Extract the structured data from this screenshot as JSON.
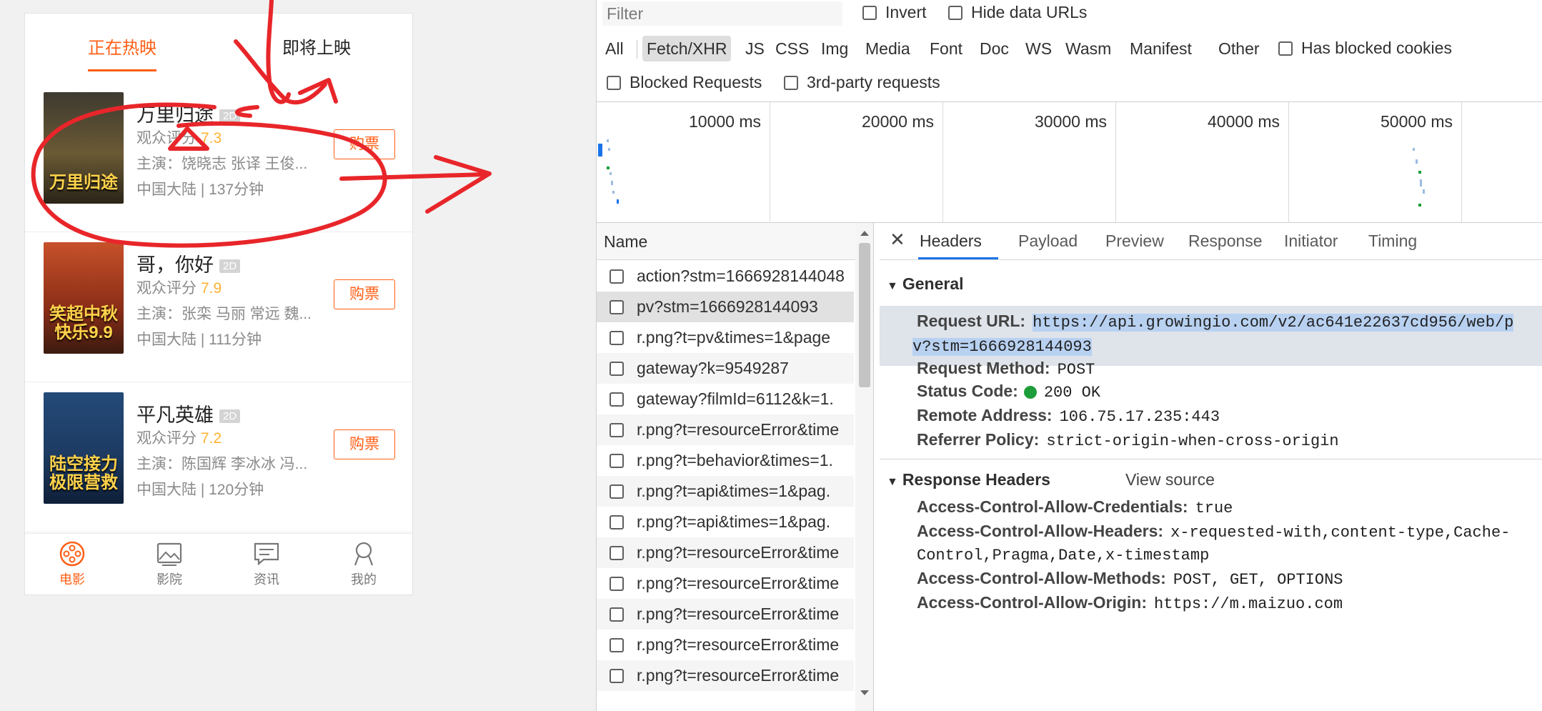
{
  "phone": {
    "tabs": {
      "now_showing": "正在热映",
      "coming_soon": "即将上映"
    },
    "movies": [
      {
        "title": "万里归途",
        "format": "2D",
        "score_label": "观众评分",
        "score": "7.3",
        "actors": "主演：饶晓志 张译 王俊...",
        "meta": "中国大陆 | 137分钟",
        "buy": "购票",
        "poster_text": "万里归途",
        "poster_color": "#5a4b2a"
      },
      {
        "title": "哥，你好",
        "format": "2D",
        "score_label": "观众评分",
        "score": "7.9",
        "actors": "主演：张栾 马丽 常远 魏...",
        "meta": "中国大陆 | 111分钟",
        "buy": "购票",
        "poster_text": "笑超中秋 快乐9.9",
        "poster_color": "#a0421f"
      },
      {
        "title": "平凡英雄",
        "format": "2D",
        "score_label": "观众评分",
        "score": "7.2",
        "actors": "主演：陈国辉 李冰冰 冯...",
        "meta": "中国大陆 | 120分钟",
        "buy": "购票",
        "poster_text": "陆空接力 极限营救",
        "poster_color": "#1d3b63"
      }
    ],
    "bottom_nav": [
      {
        "label": "电影",
        "icon": "film-reel-icon",
        "active": true
      },
      {
        "label": "影院",
        "icon": "cinema-picture-icon",
        "active": false
      },
      {
        "label": "资讯",
        "icon": "news-message-icon",
        "active": false
      },
      {
        "label": "我的",
        "icon": "profile-icon",
        "active": false
      }
    ],
    "accent": "#ff5f16"
  },
  "devtools": {
    "filter_placeholder": "Filter",
    "invert_label": "Invert",
    "hide_data_urls_label": "Hide data URLs",
    "type_filters": [
      "All",
      "Fetch/XHR",
      "JS",
      "CSS",
      "Img",
      "Media",
      "Font",
      "Doc",
      "WS",
      "Wasm",
      "Manifest",
      "Other"
    ],
    "active_type": "Fetch/XHR",
    "has_blocked_cookies_label": "Has blocked cookies",
    "blocked_requests_label": "Blocked Requests",
    "third_party_label": "3rd-party requests",
    "timeline_ticks": [
      "10000 ms",
      "20000 ms",
      "30000 ms",
      "40000 ms",
      "50000 ms"
    ],
    "name_header": "Name",
    "requests": [
      "action?stm=1666928144048",
      "pv?stm=1666928144093",
      "r.png?t=pv&times=1&page",
      "gateway?k=9549287",
      "gateway?filmId=6112&k=1.",
      "r.png?t=resourceError&time",
      "r.png?t=behavior&times=1.",
      "r.png?t=api&times=1&pag.",
      "r.png?t=api&times=1&pag.",
      "r.png?t=resourceError&time",
      "r.png?t=resourceError&time",
      "r.png?t=resourceError&time",
      "r.png?t=resourceError&time",
      "r.png?t=resourceError&time"
    ],
    "selected_index": 1,
    "detail_tabs": [
      "Headers",
      "Payload",
      "Preview",
      "Response",
      "Initiator",
      "Timing"
    ],
    "active_detail_tab": "Headers",
    "general": {
      "title": "General",
      "request_url_label": "Request URL:",
      "request_url_line1": "https://api.growingio.com/v2/ac641e22637cd956/web/p",
      "request_url_line2": "v?stm=1666928144093",
      "method_label": "Request Method:",
      "method": "POST",
      "status_label": "Status Code:",
      "status": "200 OK",
      "remote_label": "Remote Address:",
      "remote": "106.75.17.235:443",
      "referrer_label": "Referrer Policy:",
      "referrer": "strict-origin-when-cross-origin"
    },
    "response_headers": {
      "title": "Response Headers",
      "view_source": "View source",
      "acac_label": "Access-Control-Allow-Credentials:",
      "acac": "true",
      "acah_label": "Access-Control-Allow-Headers:",
      "acah_line1": "x-requested-with,content-type,Cache-",
      "acah_line2": "Control,Pragma,Date,x-timestamp",
      "acam_label": "Access-Control-Allow-Methods:",
      "acam": "POST, GET, OPTIONS",
      "acao_label": "Access-Control-Allow-Origin:",
      "acao": "https://m.maizuo.com"
    }
  }
}
